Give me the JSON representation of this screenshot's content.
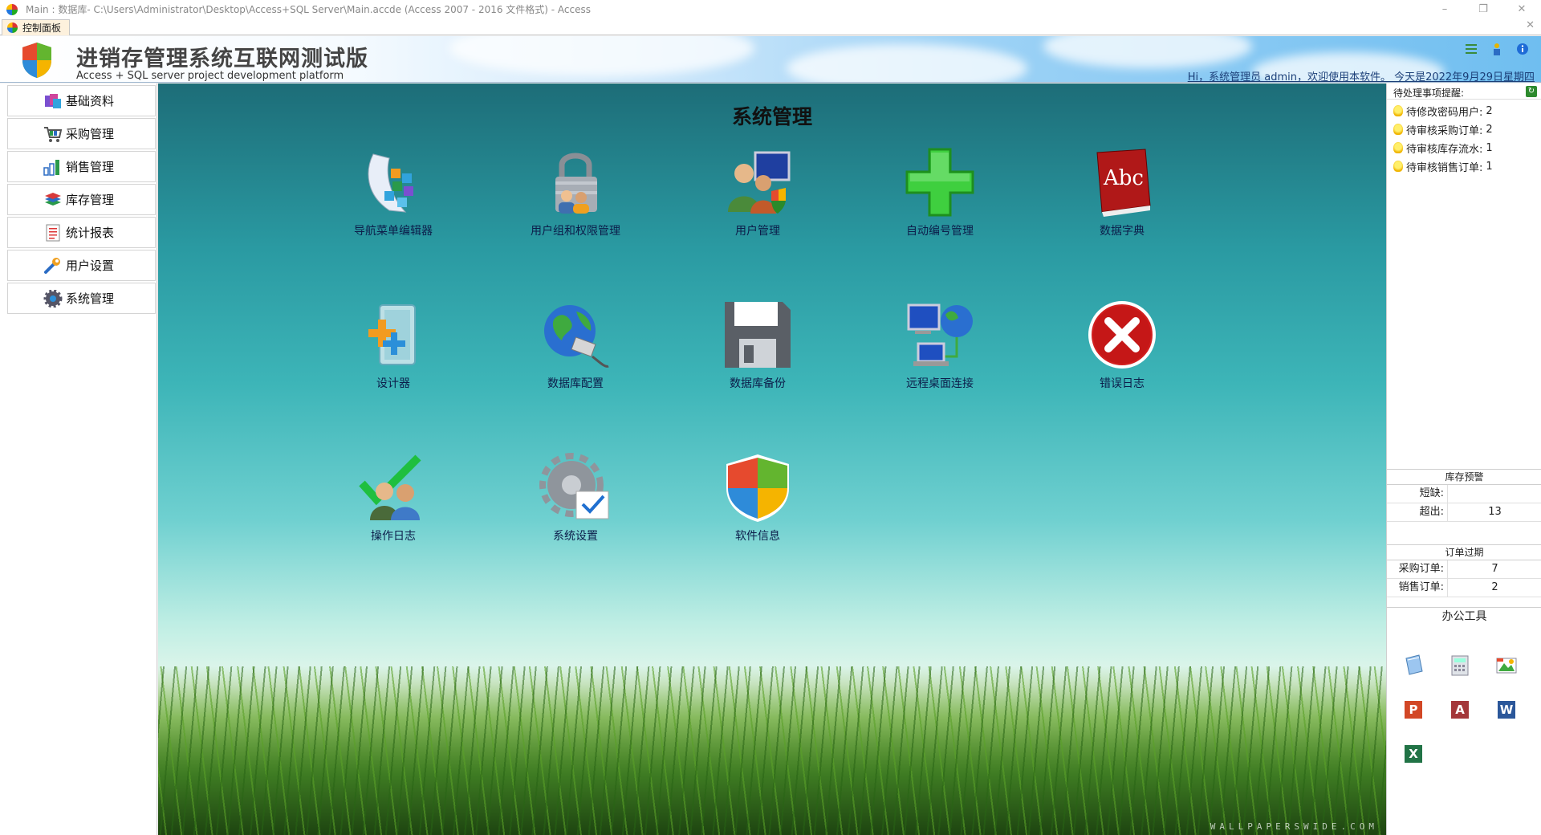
{
  "window": {
    "title": "Main : 数据库- C:\\Users\\Administrator\\Desktop\\Access+SQL Server\\Main.accde (Access 2007 - 2016 文件格式) - Access",
    "controls": {
      "minimize": "–",
      "restore": "❐",
      "close": "✕"
    }
  },
  "doc_tab": {
    "label": "控制面板",
    "close": "✕"
  },
  "header": {
    "title": "进销存管理系统互联网测试版",
    "subtitle": "Access + SQL server project development platform",
    "greeting": "Hi，系统管理员  admin，欢迎使用本软件。  今天是2022年9月29日星期四",
    "icons": [
      "list-icon",
      "user-icon",
      "info-icon"
    ]
  },
  "nav": {
    "items": [
      {
        "label": "基础资料",
        "icon": "basic-data-icon"
      },
      {
        "label": "采购管理",
        "icon": "purchase-icon"
      },
      {
        "label": "销售管理",
        "icon": "sales-chart-icon"
      },
      {
        "label": "库存管理",
        "icon": "inventory-icon"
      },
      {
        "label": "统计报表",
        "icon": "report-icon"
      },
      {
        "label": "用户设置",
        "icon": "wrench-icon"
      },
      {
        "label": "系统管理",
        "icon": "gear-icon"
      }
    ]
  },
  "main": {
    "section_title": "系统管理",
    "watermark": "WALLPAPERSWIDE.COM",
    "tiles": [
      {
        "label": "导航菜单编辑器",
        "icon": "menu-editor-icon"
      },
      {
        "label": "用户组和权限管理",
        "icon": "lock-users-icon"
      },
      {
        "label": "用户管理",
        "icon": "user-management-icon"
      },
      {
        "label": "自动编号管理",
        "icon": "green-plus-icon"
      },
      {
        "label": "数据字典",
        "icon": "dictionary-book-icon",
        "book_text": "Abc"
      },
      {
        "label": "设计器",
        "icon": "designer-icon"
      },
      {
        "label": "数据库配置",
        "icon": "globe-network-icon"
      },
      {
        "label": "数据库备份",
        "icon": "floppy-disk-icon"
      },
      {
        "label": "远程桌面连接",
        "icon": "remote-desktop-icon"
      },
      {
        "label": "错误日志",
        "icon": "error-x-icon"
      },
      {
        "label": "操作日志",
        "icon": "operation-log-icon"
      },
      {
        "label": "系统设置",
        "icon": "settings-check-icon"
      },
      {
        "label": "软件信息",
        "icon": "windows-shield-icon"
      }
    ]
  },
  "right": {
    "todo_title": "待处理事项提醒:",
    "todo": [
      {
        "label": "待修改密码用户:",
        "value": "2"
      },
      {
        "label": "待审核采购订单:",
        "value": "2"
      },
      {
        "label": "待审核库存流水:",
        "value": "1"
      },
      {
        "label": "待审核销售订单:",
        "value": "1"
      }
    ],
    "stock_alert": {
      "title": "库存预警",
      "rows": [
        {
          "label": "短缺:",
          "value": ""
        },
        {
          "label": "超出:",
          "value": "13"
        }
      ]
    },
    "order_expiry": {
      "title": "订单过期",
      "rows": [
        {
          "label": "采购订单:",
          "value": "7"
        },
        {
          "label": "销售订单:",
          "value": "2"
        }
      ]
    },
    "tools": {
      "title": "办公工具",
      "items": [
        {
          "icon": "notepad-icon",
          "text": ""
        },
        {
          "icon": "calculator-icon",
          "text": ""
        },
        {
          "icon": "paint-icon",
          "text": ""
        },
        {
          "icon": "powerpoint-icon",
          "text": "P",
          "color": "#d24726"
        },
        {
          "icon": "access-icon",
          "text": "A",
          "color": "#a4373a"
        },
        {
          "icon": "word-icon",
          "text": "W",
          "color": "#2b579a"
        },
        {
          "icon": "excel-icon",
          "text": "X",
          "color": "#217346"
        }
      ]
    }
  },
  "colors": {
    "main_bg_top": "#1d6d78",
    "main_bg_mid": "#3db5b8",
    "grass": "#3d7a22",
    "label_text": "#0c1d4a"
  }
}
